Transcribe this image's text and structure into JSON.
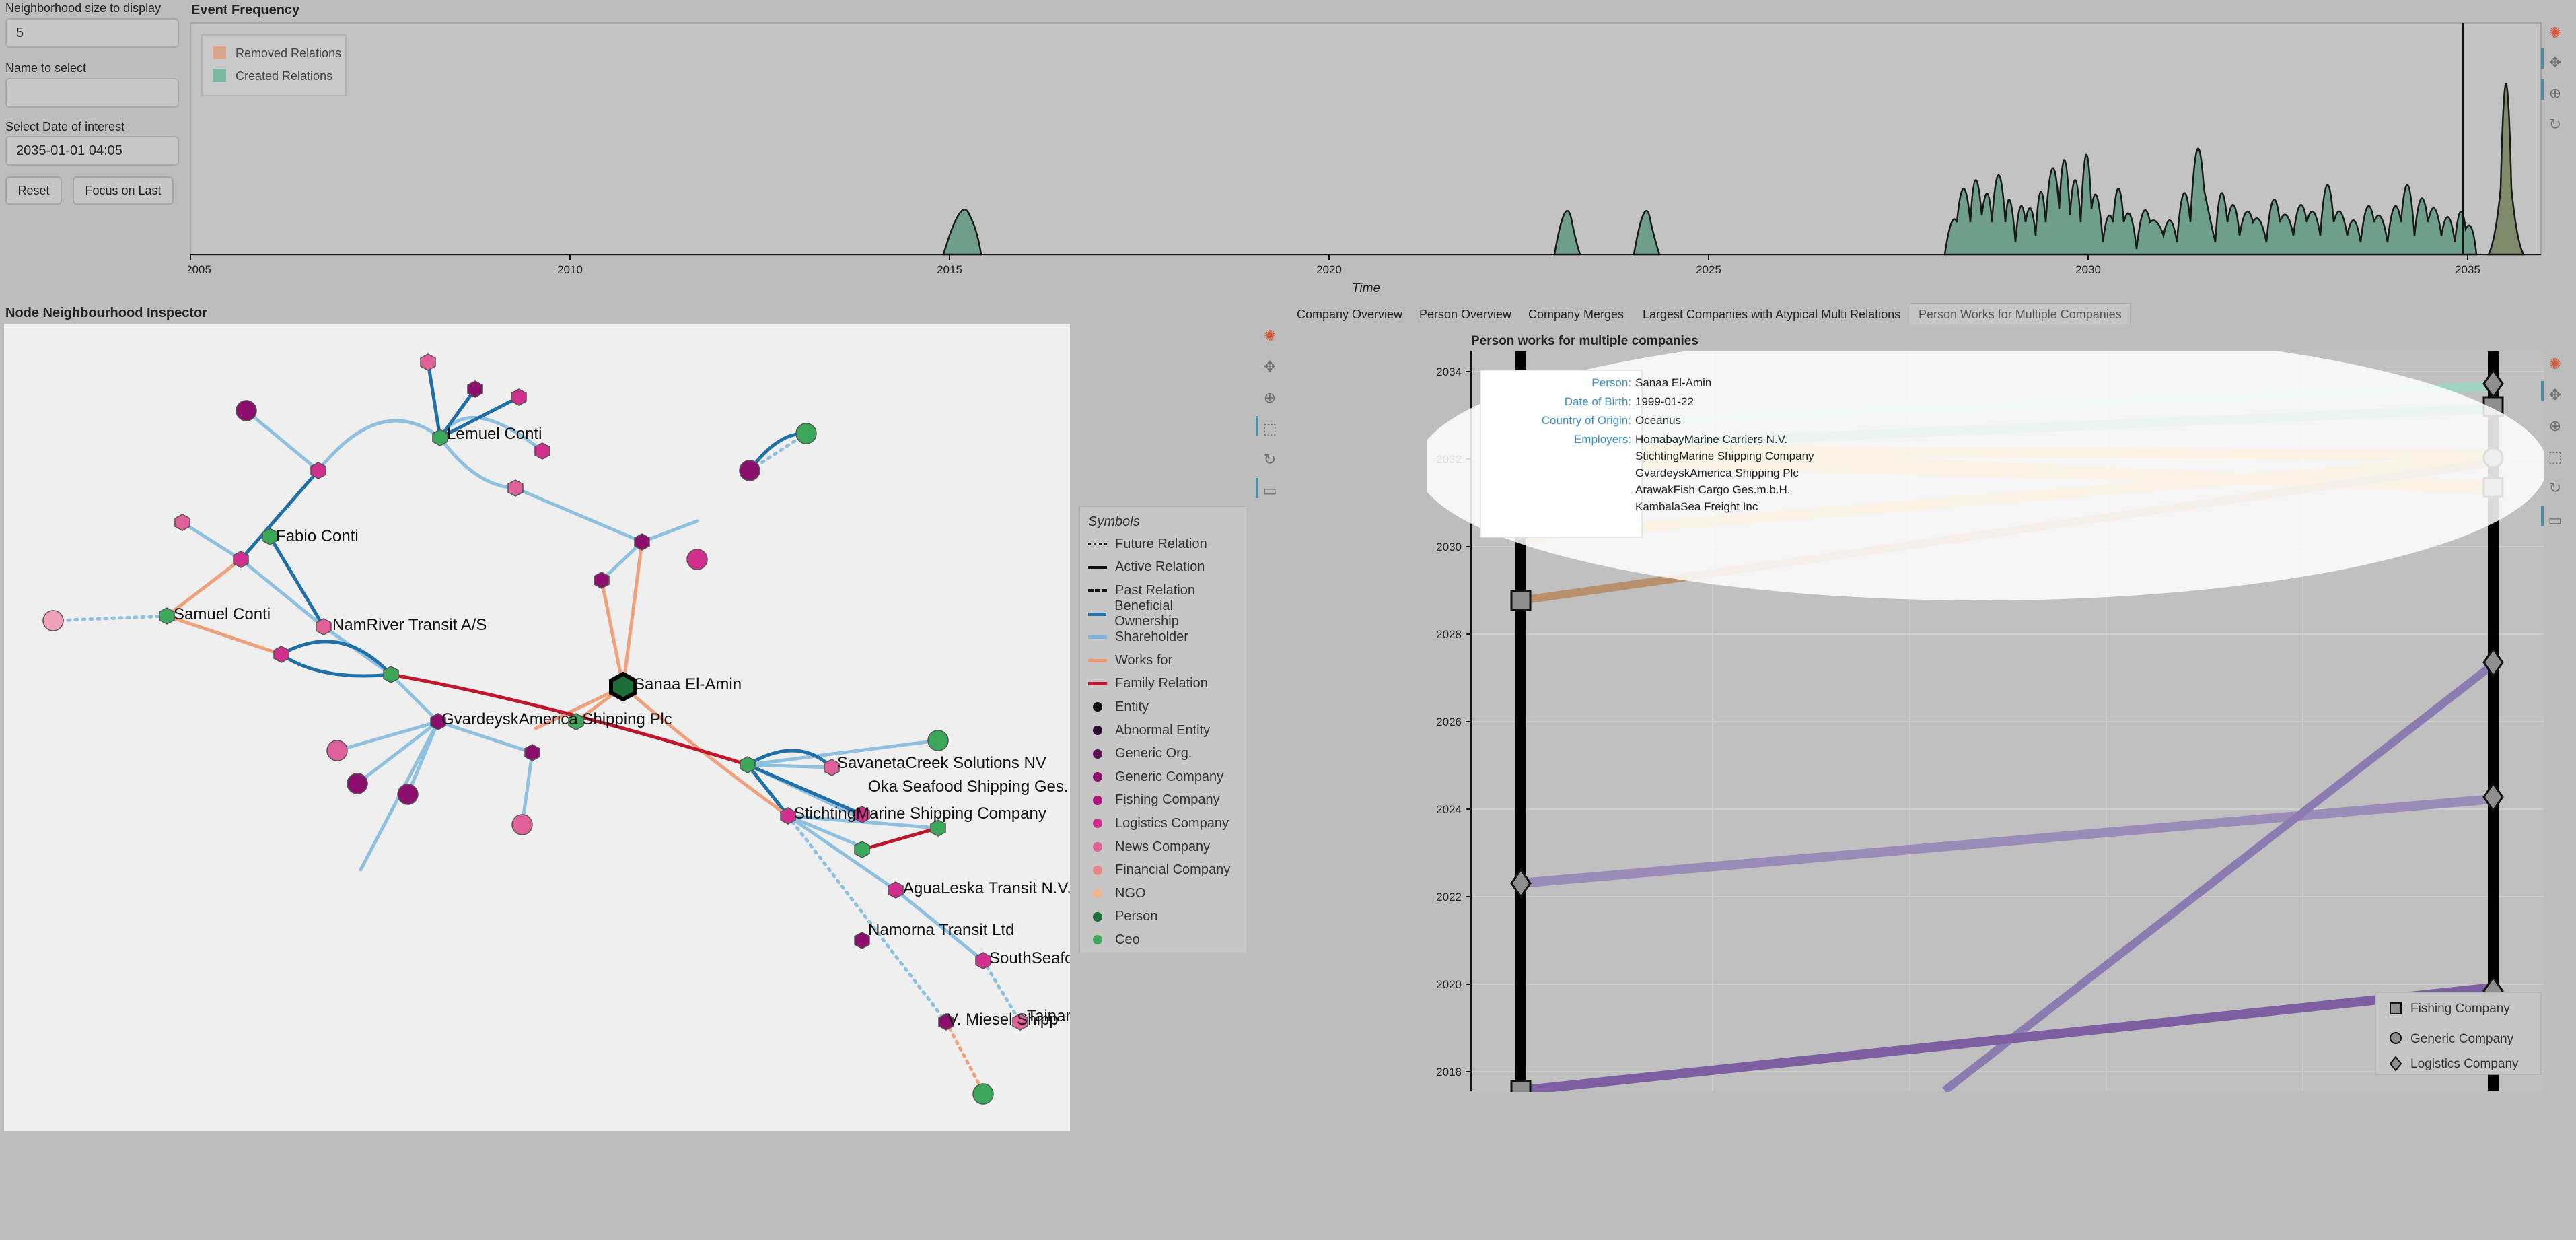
{
  "controls": {
    "neighborhood_label": "Neighborhood size to display",
    "neighborhood_value": "5",
    "name_label": "Name to select",
    "name_value": "",
    "date_label": "Select Date of interest",
    "date_value": "2035-01-01 04:05",
    "reset_label": "Reset",
    "focus_label": "Focus on Last"
  },
  "event_frequency": {
    "title": "Event Frequency",
    "legend": [
      {
        "label": "Removed Relations",
        "color": "#d9a38a"
      },
      {
        "label": "Created Relations",
        "color": "#7ab8a0"
      }
    ],
    "xlabel": "Time",
    "ticks": [
      "2005",
      "2010",
      "2015",
      "2020",
      "2025",
      "2030",
      "2035"
    ]
  },
  "inspector": {
    "title": "Node Neighbourhood Inspector",
    "node_labels": [
      "Lemuel Conti",
      "Fabio Conti",
      "Samuel Conti",
      "NamRiver Transit A/S",
      "Sanaa El-Amin",
      "GvardeyskAmerica Shipping Plc",
      "SavanetaCreek Solutions NV",
      "Oka Seafood Shipping Ges.",
      "StichtingMarine Shipping Company",
      "AguaLeska Transit N.V.",
      "Namorna Transit Ltd",
      "SouthSeafo",
      "V. Miesel Shipp",
      "Tainam"
    ],
    "symbols_title": "Symbols",
    "symbols": [
      {
        "label": "Future Relation",
        "kind": "line",
        "style": "dotted",
        "color": "#111111"
      },
      {
        "label": "Active Relation",
        "kind": "line",
        "style": "solid",
        "color": "#111111"
      },
      {
        "label": "Past Relation",
        "kind": "line",
        "style": "dashed",
        "color": "#111111"
      },
      {
        "label": "Beneficial Ownership",
        "kind": "line",
        "style": "solid",
        "color": "#1f6fa8"
      },
      {
        "label": "Shareholder",
        "kind": "line",
        "style": "solid",
        "color": "#7fb3d9"
      },
      {
        "label": "Works for",
        "kind": "line",
        "style": "solid",
        "color": "#f0956e"
      },
      {
        "label": "Family Relation",
        "kind": "line",
        "style": "solid",
        "color": "#c0152a"
      },
      {
        "label": "Entity",
        "kind": "dot",
        "color": "#111111"
      },
      {
        "label": "Abnormal Entity",
        "kind": "dot",
        "color": "#2a0f2e"
      },
      {
        "label": "Generic Org.",
        "kind": "dot",
        "color": "#5a1050"
      },
      {
        "label": "Generic Company",
        "kind": "dot",
        "color": "#8c0f6e"
      },
      {
        "label": "Fishing Company",
        "kind": "dot",
        "color": "#b0177e"
      },
      {
        "label": "Logistics Company",
        "kind": "dot",
        "color": "#d02f8e"
      },
      {
        "label": "News Company",
        "kind": "dot",
        "color": "#e0609a"
      },
      {
        "label": "Financial Company",
        "kind": "dot",
        "color": "#e8868a"
      },
      {
        "label": "NGO",
        "kind": "dot",
        "color": "#f0b48a"
      },
      {
        "label": "Person",
        "kind": "dot",
        "color": "#1e6e3a"
      },
      {
        "label": "Ceo",
        "kind": "dot",
        "color": "#3aa858"
      }
    ]
  },
  "tabs": [
    {
      "label": "Company Overview",
      "active": false
    },
    {
      "label": "Person Overview",
      "active": false
    },
    {
      "label": "Company Merges",
      "active": false
    },
    {
      "label": "Largest Companies with Atypical Multi Relations",
      "active": false
    },
    {
      "label": "Person Works for Multiple Companies",
      "active": true
    }
  ],
  "person_chart": {
    "title": "Person works for multiple companies",
    "y_ticks": [
      "2034",
      "2032",
      "2030",
      "2028",
      "2026",
      "2024",
      "2022",
      "2020",
      "2018"
    ],
    "tooltip": {
      "person_key": "Person:",
      "person": "Sanaa El-Amin",
      "dob_key": "Date of Birth:",
      "dob": "1999-01-22",
      "country_key": "Country of Origin:",
      "country": "Oceanus",
      "employers_key": "Employers:",
      "employers": [
        "HomabayMarine Carriers N.V.",
        "StichtingMarine Shipping Company",
        "GvardeyskAmerica Shipping Plc",
        "ArawakFish Cargo Ges.m.b.H.",
        "KambalaSea Freight Inc"
      ]
    },
    "legend": [
      {
        "label": "Fishing Company",
        "marker": "square"
      },
      {
        "label": "Generic Company",
        "marker": "circle"
      },
      {
        "label": "Logistics Company",
        "marker": "diamond"
      }
    ]
  }
}
